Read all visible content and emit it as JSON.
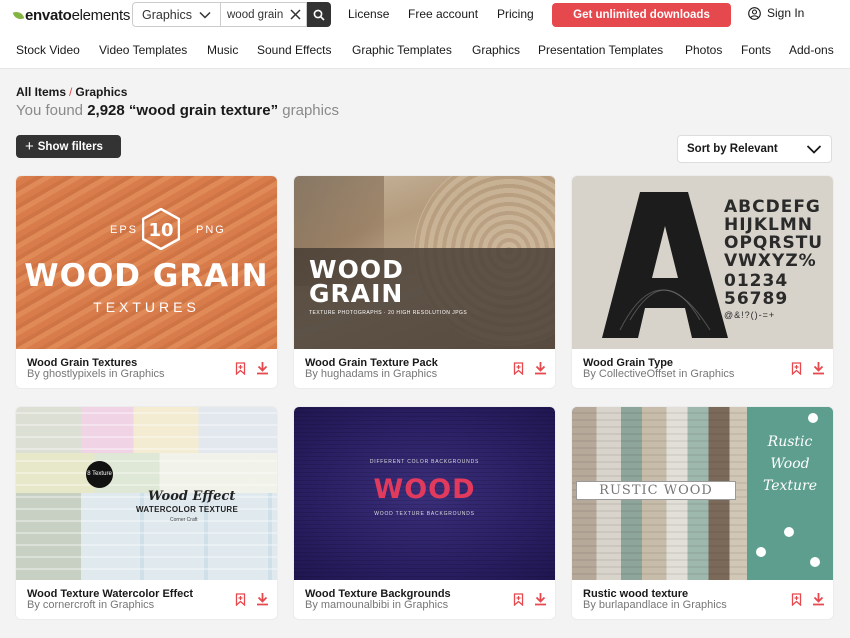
{
  "header": {
    "logo_bold": "envato",
    "logo_light": "elements",
    "search": {
      "category": "Graphics",
      "query": "wood grain"
    },
    "links": [
      "License",
      "Free account",
      "Pricing"
    ],
    "cta": "Get unlimited downloads",
    "signin": "Sign In"
  },
  "nav": [
    "Stock Video",
    "Video Templates",
    "Music",
    "Sound Effects",
    "Graphic Templates",
    "Graphics",
    "Presentation Templates",
    "Photos",
    "Fonts",
    "Add-ons"
  ],
  "breadcrumb": {
    "root": "All Items",
    "sep": "/",
    "current": "Graphics"
  },
  "results": {
    "prefix": "You found",
    "count": "2,928",
    "query": "“wood grain texture”",
    "suffix": "graphics"
  },
  "filters_label": "Show filters",
  "sort_label": "Sort by Relevant",
  "cards": [
    {
      "title": "Wood Grain Textures",
      "author": "By ghostlypixels in Graphics",
      "art": {
        "big": "WOOD GRAIN",
        "sub": "TEXTURES",
        "left": "EPS",
        "right": "PNG",
        "num": "10"
      }
    },
    {
      "title": "Wood Grain Texture Pack",
      "author": "By hughadams in Graphics",
      "art": {
        "line1": "WOOD",
        "line2": "GRAIN",
        "small": "TEXTURE PHOTOGRAPHS · 20 HIGH RESOLUTION JPGS"
      }
    },
    {
      "title": "Wood Grain Type",
      "author": "By CollectiveOffset in Graphics",
      "art": {
        "letters": "ABCDEFG HIJKLMN OPQRSTU VWXYZ%",
        "digits": "01234 56789",
        "symbols": "@&!?()-=+"
      }
    },
    {
      "title": "Wood Texture Watercolor Effect",
      "author": "By cornercroft in Graphics",
      "art": {
        "badge": "8 Texture",
        "line1": "Wood Effect",
        "line2": "WATERCOLOR TEXTURE",
        "line3": "Corner Craft"
      }
    },
    {
      "title": "Wood Texture Backgrounds",
      "author": "By mamounalbibi in Graphics",
      "art": {
        "top": "DIFFERENT COLOR BACKGROUNDS",
        "big": "WOOD",
        "bottom": "WOOD TEXTURE BACKGROUNDS"
      }
    },
    {
      "title": "Rustic wood texture",
      "author": "By burlapandlace in Graphics",
      "art": {
        "banner": "RUSTIC WOOD",
        "side1": "Rustic Wood",
        "side2": "Texture"
      }
    }
  ]
}
